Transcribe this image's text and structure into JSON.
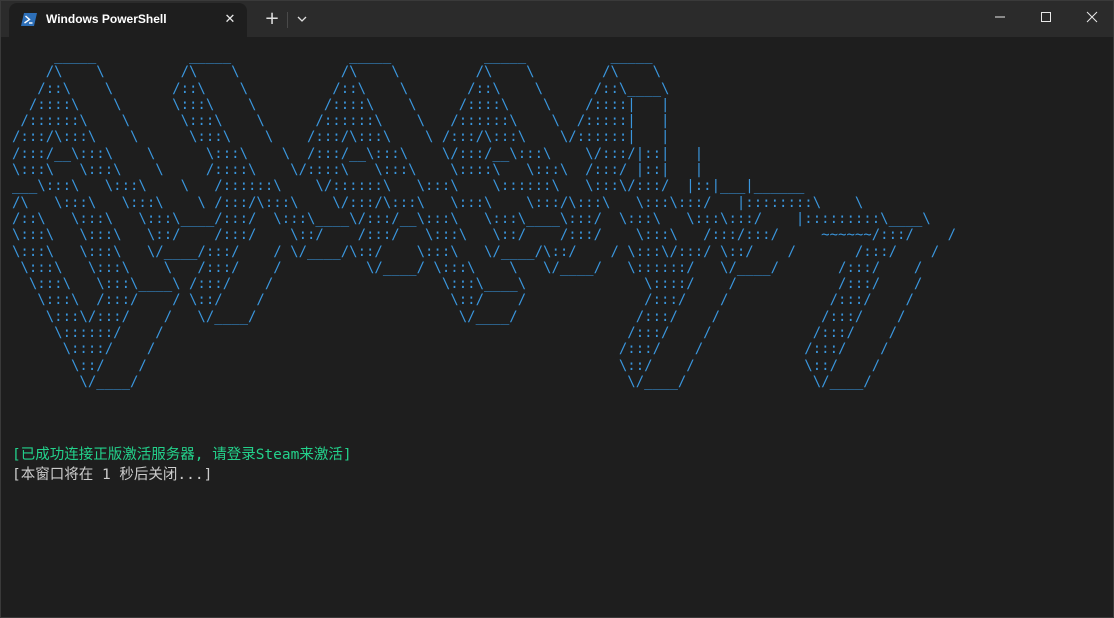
{
  "window": {
    "tab_title": "Windows PowerShell",
    "tab_icon": "powershell-icon",
    "close_tab_glyph": "✕",
    "new_tab_glyph": "+",
    "dropdown_icon": "chevron-down-icon",
    "controls": [
      "minimize-icon",
      "maximize-icon",
      "close-icon"
    ]
  },
  "console": {
    "banner_ascii": "     _____           _____              _____           _____          _____\n    /\\    \\         /\\    \\            /\\    \\         /\\    \\        /\\    \\\n   /::\\    \\       /::\\    \\          /::\\    \\       /::\\    \\      /::\\____\\\n  /::::\\    \\      \\:::\\    \\        /::::\\    \\     /::::\\    \\    /::::|   |\n /::::::\\    \\      \\:::\\    \\      /::::::\\    \\   /::::::\\    \\  /:::::|   |\n/:::/\\:::\\    \\      \\:::\\    \\    /:::/\\:::\\    \\ /:::/\\:::\\    \\/::::::|   |\n/:::/__\\:::\\    \\      \\:::\\    \\  /:::/__\\:::\\    \\/:::/__\\:::\\    \\/:::/|::|   |\n\\:::\\   \\:::\\    \\     /::::\\    \\/::::\\   \\:::\\    \\::::\\   \\:::\\  /:::/ |::|   |\n___\\:::\\   \\:::\\    \\   /::::::\\    \\/::::::\\   \\:::\\    \\::::::\\   \\:::\\/:::/  |::|___|______\n/\\   \\:::\\   \\:::\\    \\ /:::/\\:::\\    \\/:::/\\:::\\   \\:::\\    \\:::/\\:::\\   \\:::\\:::/   |::::::::\\    \\\n/::\\   \\:::\\   \\:::\\____/:::/  \\:::\\____\\/:::/__\\:::\\   \\:::\\____\\:::/  \\:::\\   \\:::\\:::/    |:::::::::\\____\\\n\\:::\\   \\:::\\   \\::/    /:::/    \\::/    /:::/   \\:::\\   \\::/    /:::/    \\:::\\   /:::/:::/     ~~~~~~/:::/    /\n\\:::\\   \\:::\\   \\/____/:::/    / \\/____/\\::/    \\:::\\   \\/____/\\::/    / \\:::\\/:::/ \\::/    /       /:::/    /\n \\:::\\   \\:::\\    \\   /:::/    /          \\/____/ \\:::\\    \\   \\/____/   \\::::::/   \\/____/       /:::/    /\n  \\:::\\   \\:::\\____\\ /:::/    /                    \\:::\\____\\              \\::::/    /            /:::/    /\n   \\:::\\  /:::/    / \\::/    /                      \\::/    /              /:::/    /            /:::/    /\n    \\:::\\/:::/    /   \\/____/                        \\/____/              /:::/    /            /:::/    /\n     \\::::::/    /                                                       /:::/    /            /:::/    /\n      \\::::/    /                                                       /:::/    /            /:::/    /\n       \\::/    /                                                        \\::/    /             \\::/    /\n        \\/____/                                                          \\/____/               \\/____/",
    "success_message": "[已成功连接正版激活服务器, 请登录Steam来激活]",
    "closing_message": "[本窗口将在 1 秒后关闭...]"
  },
  "colors": {
    "background": "#1e1e1e",
    "titlebar": "#2b2b2b",
    "banner": "#3a96dd",
    "success": "#23d18b",
    "text": "#cccccc"
  }
}
